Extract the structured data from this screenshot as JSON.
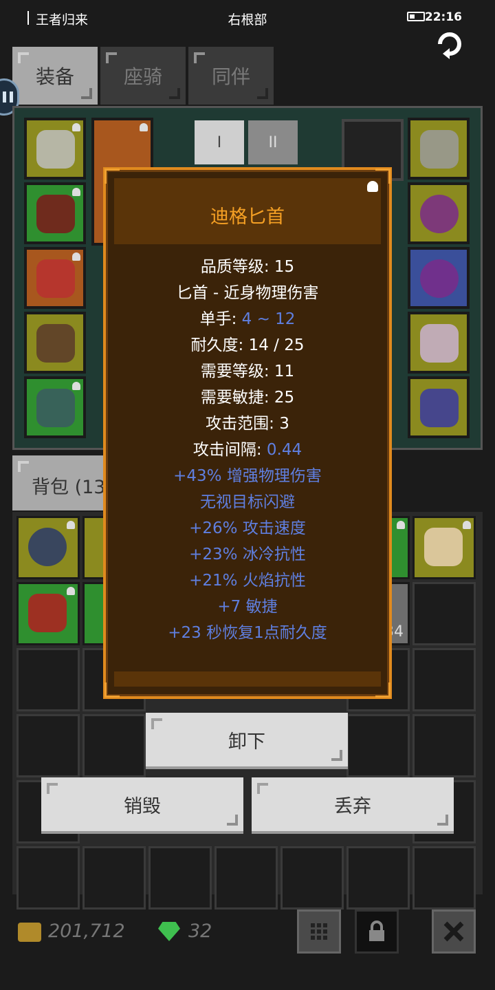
{
  "status_bar": {
    "left_text": "王者归来",
    "center_text": "右根部",
    "time": "22:16"
  },
  "tabs": [
    {
      "label": "装备"
    },
    {
      "label": "座骑"
    },
    {
      "label": "同伴"
    }
  ],
  "equip_tabs": [
    {
      "label": "I"
    },
    {
      "label": "II"
    }
  ],
  "bag": {
    "tab_label": "背包 (13",
    "partial_count": "34"
  },
  "tooltip": {
    "title": "迪格匕首",
    "lines": [
      {
        "label": "品质等级: ",
        "value": "15",
        "value_color": "white"
      },
      {
        "label": "匕首 - 近身物理伤害",
        "value": "",
        "value_color": "white"
      },
      {
        "label": "单手: ",
        "value": "4 ~ 12",
        "value_color": "blue"
      },
      {
        "label": "耐久度: ",
        "value": "14 / 25",
        "value_color": "white"
      },
      {
        "label": "需要等级: ",
        "value": "11",
        "value_color": "white"
      },
      {
        "label": "需要敏捷: ",
        "value": "25",
        "value_color": "white"
      },
      {
        "label": "攻击范围: ",
        "value": "3",
        "value_color": "white"
      },
      {
        "label": "攻击间隔: ",
        "value": "0.44",
        "value_color": "blue"
      }
    ],
    "affixes": [
      "+43% 增强物理伤害",
      "无视目标闪避",
      "+26% 攻击速度",
      "+23% 冰冷抗性",
      "+21% 火焰抗性",
      "+7 敏捷",
      "+23 秒恢复1点耐久度"
    ]
  },
  "actions": {
    "unequip": "卸下",
    "destroy": "销毁",
    "discard": "丢弃"
  },
  "currency": {
    "gold": "201,712",
    "gems": "32"
  },
  "colors": {
    "tooltip_border": "#e08a1e",
    "title": "#f5a024",
    "affix": "#5f7fe0"
  }
}
